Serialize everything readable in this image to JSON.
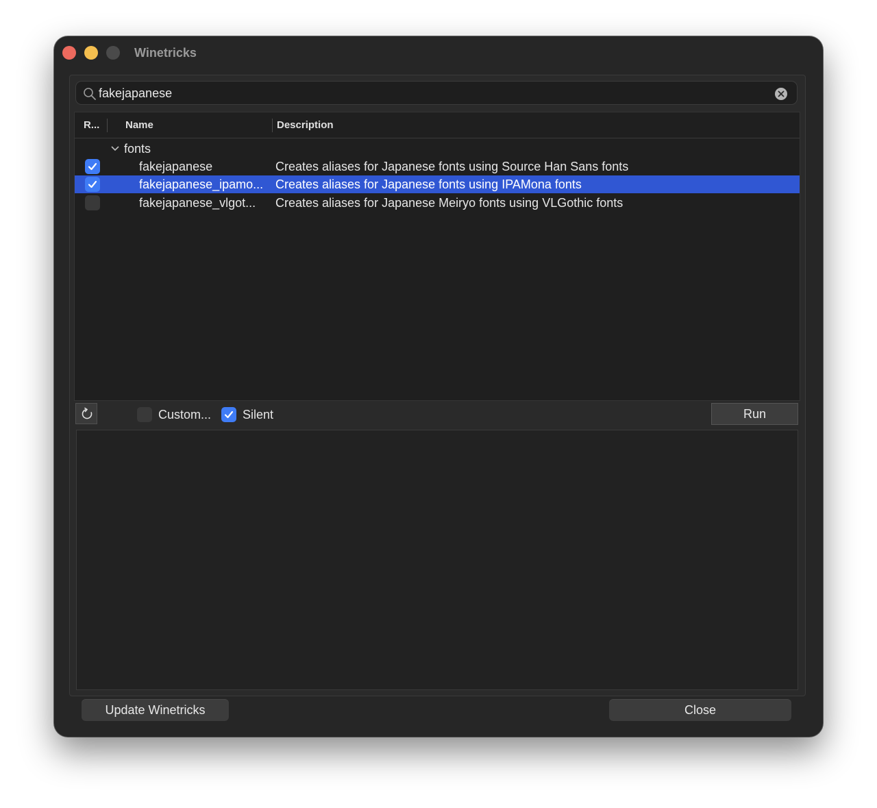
{
  "window": {
    "title": "Winetricks"
  },
  "search": {
    "value": "fakejapanese"
  },
  "table": {
    "columns": {
      "run": "R...",
      "name": "Name",
      "description": "Description"
    },
    "group": {
      "label": "fonts",
      "expanded": true
    },
    "rows": [
      {
        "checked": true,
        "selected": false,
        "name": "fakejapanese",
        "description": "Creates aliases for Japanese fonts using Source Han Sans fonts"
      },
      {
        "checked": true,
        "selected": true,
        "name": "fakejapanese_ipamo...",
        "description": "Creates aliases for Japanese fonts using IPAMona fonts"
      },
      {
        "checked": false,
        "selected": false,
        "name": "fakejapanese_vlgot...",
        "description": "Creates aliases for Japanese Meiryo fonts using VLGothic fonts"
      }
    ]
  },
  "options": {
    "custom_label": "Custom...",
    "custom_checked": false,
    "silent_label": "Silent",
    "silent_checked": true,
    "run_label": "Run"
  },
  "footer": {
    "update_label": "Update Winetricks",
    "close_label": "Close"
  },
  "colors": {
    "selection": "#3057d3",
    "checkbox_on": "#3f7cf6",
    "close": "#ed6a5e",
    "minimize": "#f5bf4f"
  }
}
